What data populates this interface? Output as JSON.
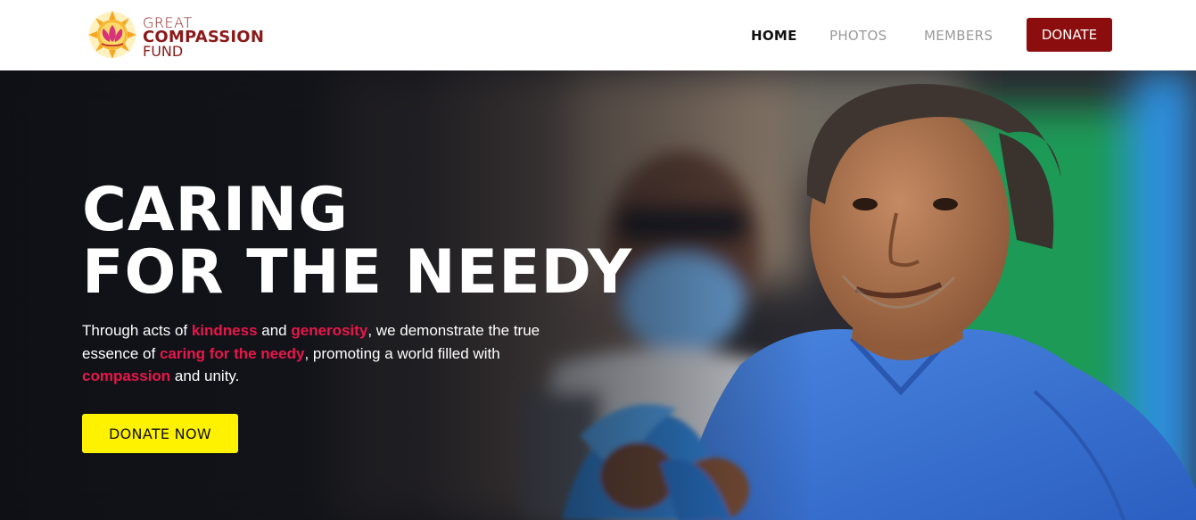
{
  "header": {
    "logo": {
      "line1": "GREAT",
      "line2": "COMPASSION",
      "line3": "FUND",
      "icon": "lotus-sun-icon"
    },
    "nav": {
      "home": "HOME",
      "photos": "PHOTOS",
      "members": "MEMBERS",
      "donate": "DONATE"
    }
  },
  "hero": {
    "title_line1": "CARING",
    "title_line2": "FOR THE NEEDY",
    "desc": {
      "t1": "Through acts of ",
      "h1": "kindness",
      "t2": " and ",
      "h2": "generosity",
      "t3": ", we demonstrate the true essence of ",
      "h3": "caring for the needy",
      "t4": ", promoting a world filled with ",
      "h4": "compassion",
      "t5": " and unity."
    },
    "cta": "DONATE NOW"
  },
  "colors": {
    "brand": "#8b0d0d",
    "highlight": "#e8174a",
    "cta": "#fff200"
  }
}
